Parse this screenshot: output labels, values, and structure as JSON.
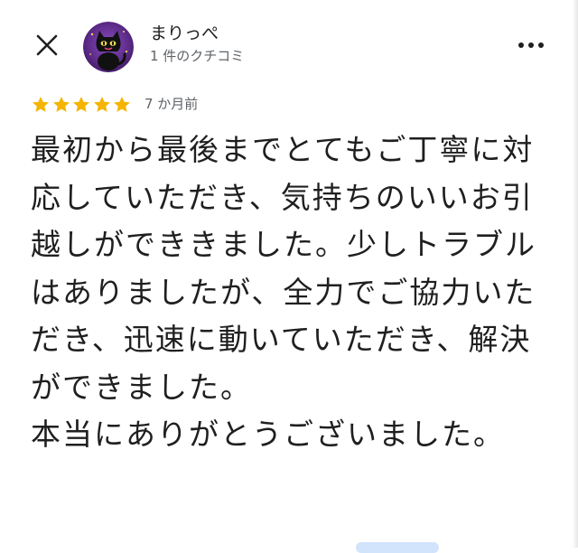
{
  "header": {
    "close_icon": "close-icon",
    "avatar_icon": "black-cat-avatar",
    "reviewer_name": "まりっぺ",
    "review_count": "1 件のクチコミ",
    "more_icon": "more-vertical-icon"
  },
  "review": {
    "rating": 5,
    "rating_max": 5,
    "star_color": "#f4b400",
    "date": "7 か月前",
    "paragraphs": [
      "最初から最後までとてもご丁寧に対応していただき、気持ちのいいお引越しができきました。少しトラブルはありましたが、全力でご協力いただき、迅速に動いていただき、解決ができました。",
      "本当にありがとうございました。"
    ]
  },
  "colors": {
    "text_primary": "#1f1f1f",
    "text_secondary": "#5f6368",
    "avatar_background": "#5b2a86"
  }
}
